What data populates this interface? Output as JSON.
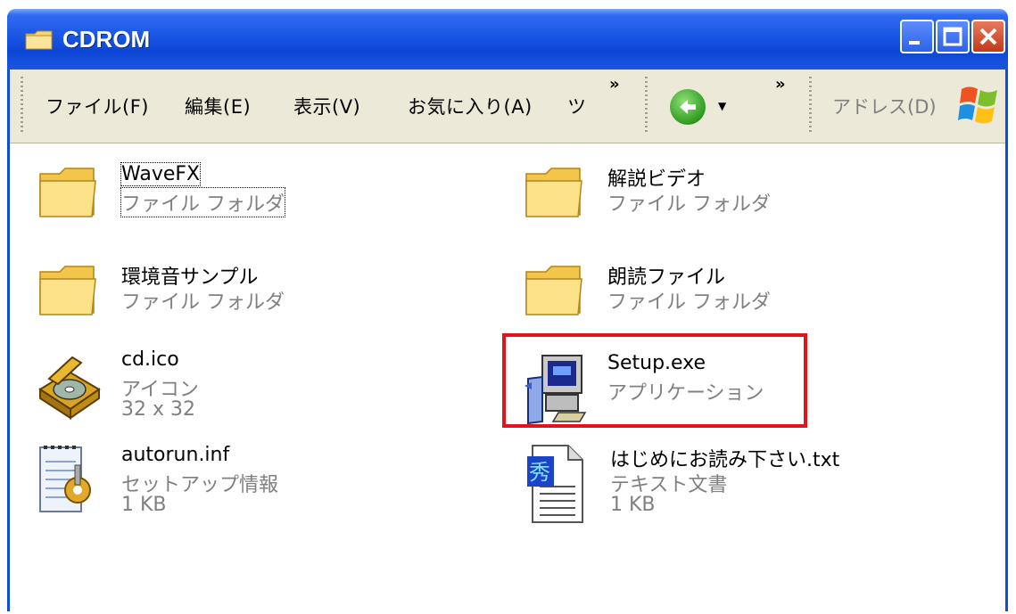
{
  "window": {
    "title": "CDROM",
    "accent": "#0b4fd8",
    "highlight_color": "#e0141a"
  },
  "menubar": {
    "items": [
      "ファイル(F)",
      "編集(E)",
      "表示(V)",
      "お気に入り(A)",
      "ツ"
    ],
    "overflow_1": "»",
    "overflow_2": "»",
    "address_label": "アドレス(D)"
  },
  "files": [
    {
      "name": "WaveFX",
      "type": "ファイル フォルダ",
      "icon": "folder-icon"
    },
    {
      "name": "解説ビデオ",
      "type": "ファイル フォルダ",
      "icon": "folder-icon"
    },
    {
      "name": "環境音サンプル",
      "type": "ファイル フォルダ",
      "icon": "folder-icon"
    },
    {
      "name": "朗読ファイル",
      "type": "ファイル フォルダ",
      "icon": "folder-icon"
    },
    {
      "name": "cd.ico",
      "type": "アイコン",
      "size": "32 x 32",
      "icon": "cd-icon"
    },
    {
      "name": "Setup.exe",
      "type": "アプリケーション",
      "icon": "setup-application-icon"
    },
    {
      "name": "autorun.inf",
      "type": "セットアップ情報",
      "size": "1 KB",
      "icon": "setup-info-icon"
    },
    {
      "name": "はじめにお読み下さい.txt",
      "type": "テキスト文書",
      "size": "1 KB",
      "icon": "text-document-icon"
    }
  ]
}
